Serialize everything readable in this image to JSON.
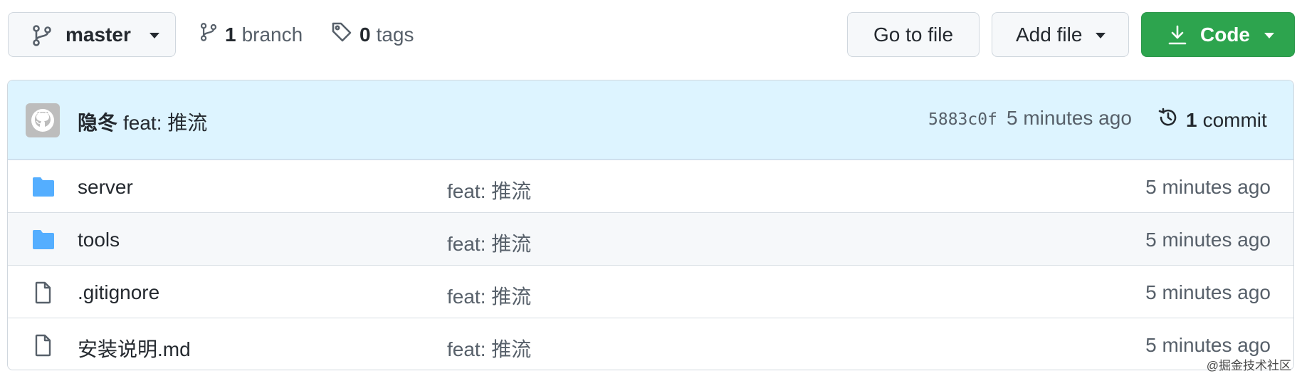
{
  "toolbar": {
    "branch_name": "master",
    "branches_count": "1",
    "branches_label": "branch",
    "tags_count": "0",
    "tags_label": "tags",
    "go_to_file_label": "Go to file",
    "add_file_label": "Add file",
    "code_label": "Code"
  },
  "latest_commit": {
    "author": "隐冬",
    "message": "feat: 推流",
    "sha": "5883c0f",
    "time": "5 minutes ago",
    "commits_count": "1",
    "commits_label": "commit"
  },
  "files": [
    {
      "name": "server",
      "type": "folder",
      "message": "feat: 推流",
      "age": "5 minutes ago"
    },
    {
      "name": "tools",
      "type": "folder",
      "message": "feat: 推流",
      "age": "5 minutes ago"
    },
    {
      "name": ".gitignore",
      "type": "file",
      "message": "feat: 推流",
      "age": "5 minutes ago"
    },
    {
      "name": "安装说明.md",
      "type": "file",
      "message": "feat: 推流",
      "age": "5 minutes ago"
    }
  ],
  "watermark": "@掘金技术社区",
  "colors": {
    "code_button": "#2da44e",
    "commit_bar": "#ddf4ff",
    "folder_icon": "#54aeff"
  }
}
